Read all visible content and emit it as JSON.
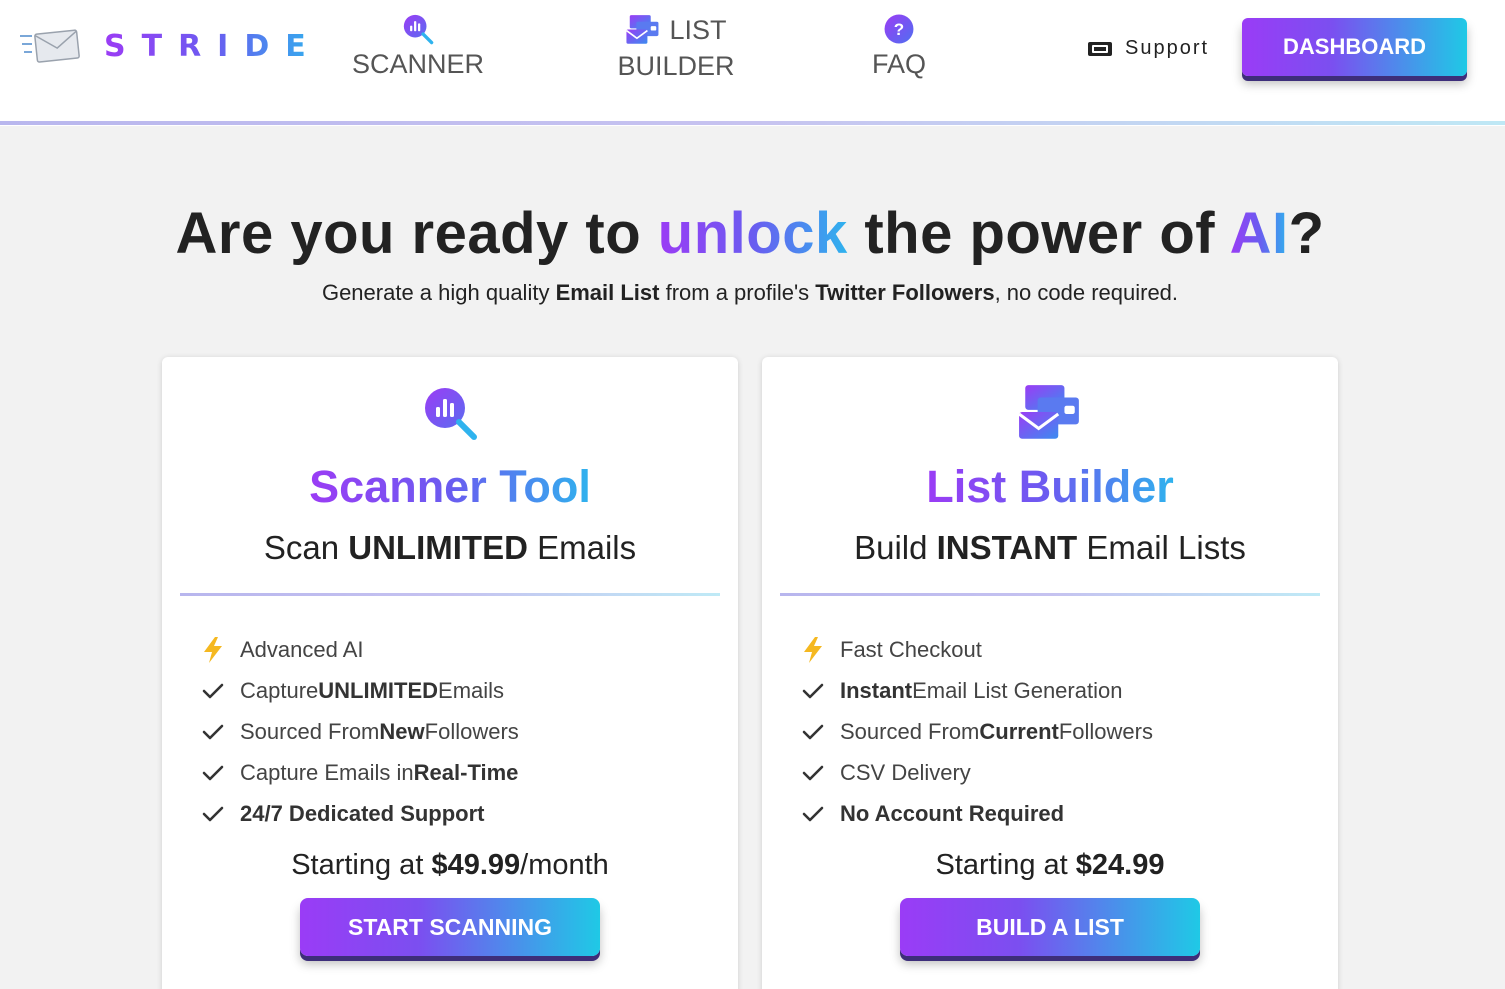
{
  "brand": {
    "name": "STRIDE",
    "logo_icon": "envelope-speed-icon"
  },
  "nav": {
    "scanner": {
      "label": "SCANNER",
      "icon": "chart-magnifier-icon"
    },
    "list_builder": {
      "label_line1": "LIST",
      "label_line2": "BUILDER",
      "icon": "stacked-envelopes-icon"
    },
    "faq": {
      "label": "FAQ",
      "icon": "question-circle-icon"
    },
    "support": {
      "label": "Support",
      "icon": "ticket-icon"
    },
    "dashboard_button": "DASHBOARD"
  },
  "hero": {
    "title_part1": "Are you ready to ",
    "title_highlight1": "unlock",
    "title_part2": " the power of ",
    "title_highlight2": "AI",
    "title_part3": "?",
    "sub_part1": "Generate a high quality ",
    "sub_bold1": "Email List",
    "sub_part2": " from a profile's ",
    "sub_bold2": "Twitter Followers",
    "sub_part3": ", no code required."
  },
  "cards": [
    {
      "title": "Scanner Tool",
      "subtitle_pre": "Scan ",
      "subtitle_bold": "UNLIMITED",
      "subtitle_post": " Emails",
      "features": [
        {
          "icon": "lightning-icon",
          "pre": "Advanced AI",
          "bold": "",
          "post": ""
        },
        {
          "icon": "check-icon",
          "pre": "Capture ",
          "bold": "UNLIMITED",
          "post": " Emails"
        },
        {
          "icon": "check-icon",
          "pre": "Sourced From ",
          "bold": "New",
          "post": " Followers"
        },
        {
          "icon": "check-icon",
          "pre": "Capture Emails in ",
          "bold": "Real-Time",
          "post": ""
        },
        {
          "icon": "check-icon",
          "pre": "",
          "bold": "24/7 Dedicated Support",
          "post": ""
        }
      ],
      "price_pre": "Starting at ",
      "price_value": "$49.99",
      "price_post": "/month",
      "button": "START SCANNING"
    },
    {
      "title": "List Builder",
      "subtitle_pre": "Build ",
      "subtitle_bold": "INSTANT",
      "subtitle_post": " Email Lists",
      "features": [
        {
          "icon": "lightning-icon",
          "pre": "Fast Checkout",
          "bold": "",
          "post": ""
        },
        {
          "icon": "check-icon",
          "pre": "",
          "bold": "Instant",
          "post": " Email List Generation"
        },
        {
          "icon": "check-icon",
          "pre": "Sourced From ",
          "bold": "Current",
          "post": " Followers"
        },
        {
          "icon": "check-icon",
          "pre": "CSV Delivery",
          "bold": "",
          "post": ""
        },
        {
          "icon": "check-icon",
          "pre": "",
          "bold": "No Account Required",
          "post": ""
        }
      ],
      "price_pre": "Starting at ",
      "price_value": "$24.99",
      "price_post": "",
      "button": "BUILD A LIST"
    }
  ],
  "colors": {
    "gradient_start": "#9b3cf5",
    "gradient_mid": "#6a5cf0",
    "gradient_end": "#2fb3ee",
    "lightning": "#f5b820",
    "page_bg": "#f2f2f2"
  }
}
